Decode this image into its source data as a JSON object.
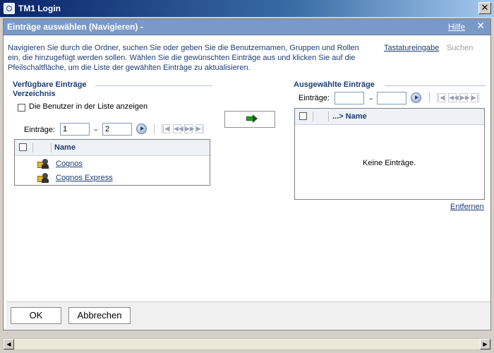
{
  "window": {
    "title": "TM1 Login",
    "close_glyph": "✕"
  },
  "dialog": {
    "title": "Einträge auswählen (Navigieren) -",
    "help": "Hilfe",
    "close_glyph": "✕"
  },
  "instructions": "Navigieren Sie durch die Ordner, suchen Sie oder geben Sie die Benutzernamen, Gruppen und Rollen ein, die hinzugefügt werden sollen. Wählen Sie die gewünschten Einträge aus und klicken Sie auf die Pfeilschaltfläche, um die Liste der gewählten Einträge zu aktualisieren.",
  "links": {
    "keyboard_input": "Tastatureingabe",
    "search": "Suchen"
  },
  "available": {
    "heading": "Verfügbare Einträge",
    "directory": "Verzeichnis",
    "show_users_label": "Die Benutzer in der Liste anzeigen",
    "show_users_checked": false,
    "entries_label": "Einträge:",
    "range_from": "1",
    "range_to": "2",
    "dash": "–",
    "column_name": "Name",
    "rows": [
      {
        "label": "Cognos",
        "icon": "user-group-icon"
      },
      {
        "label": "Cognos Express",
        "icon": "user-group-icon"
      }
    ]
  },
  "move_button_icon": "arrow-right-icon",
  "selected": {
    "heading": "Ausgewählte Einträge",
    "entries_label": "Einträge:",
    "range_from": "",
    "range_to": "",
    "dash": "–",
    "column_name": "...> Name",
    "empty_text": "Keine Einträge.",
    "remove_link": "Entfernen"
  },
  "pager_icons": [
    "first-page-icon",
    "previous-page-icon",
    "next-page-icon",
    "last-page-icon"
  ],
  "buttons": {
    "ok": "OK",
    "cancel": "Abbrechen"
  },
  "colors": {
    "accent": "#1c3d73",
    "dialog_header": "#7b99c7",
    "titlebar": "#0a246a"
  }
}
